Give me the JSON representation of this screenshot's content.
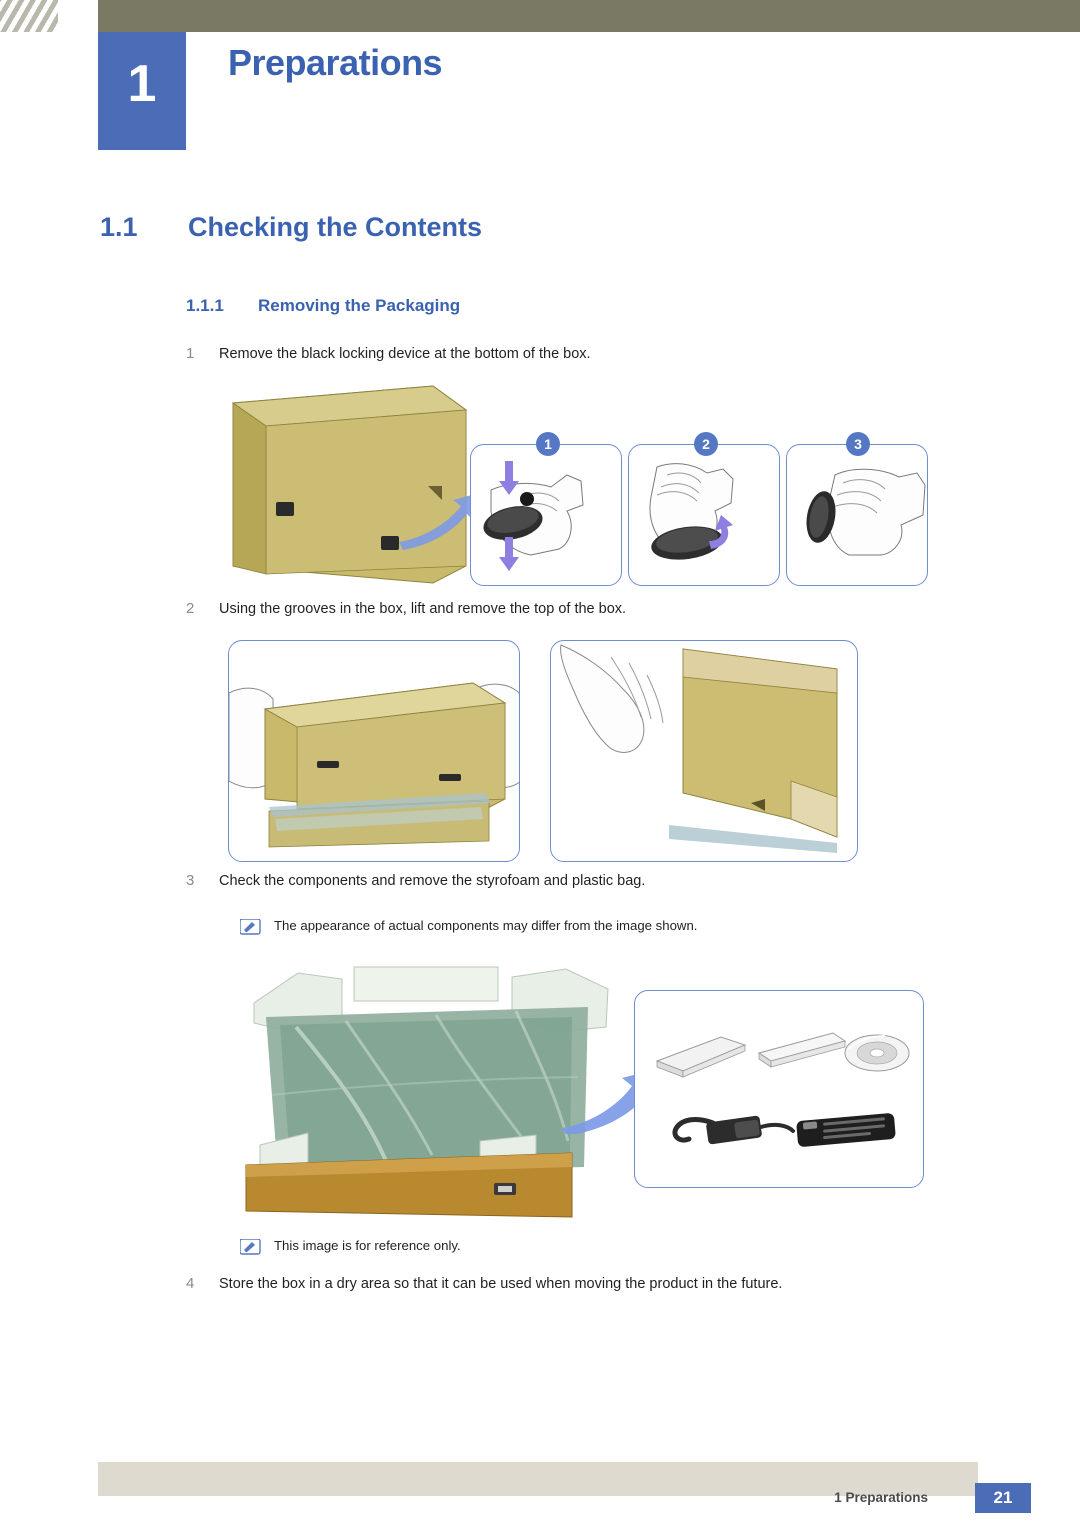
{
  "header": {
    "chapter_number": "1",
    "chapter_title": "Preparations"
  },
  "headings": {
    "h1_number": "1.1",
    "h1_text": "Checking the Contents",
    "h2_number": "1.1.1",
    "h2_text": "Removing the Packaging"
  },
  "steps": [
    {
      "num": "1",
      "text": "Remove the black locking device at the bottom of the box."
    },
    {
      "num": "2",
      "text": "Using the grooves in the box, lift and remove the top of the box."
    },
    {
      "num": "3",
      "text": "Check the components and remove the styrofoam and plastic bag."
    },
    {
      "num": "4",
      "text": "Store the box in a dry area so that it can be used when moving the product in the future."
    }
  ],
  "notes": [
    {
      "text": "The appearance of actual components may differ from the image shown."
    },
    {
      "text": "This image is for reference only."
    }
  ],
  "figure_badges": {
    "one": "1",
    "two": "2",
    "three": "3"
  },
  "footer": {
    "chapter_label": "1 Preparations",
    "page_number": "21"
  },
  "colors": {
    "accent_blue": "#3a62b0",
    "chapter_block": "#4b6cb7",
    "header_band": "#7a7a64",
    "footer_band": "#dedacf",
    "frame_border": "#6f8ed0",
    "step_number": "#8a8a8a",
    "box_tan": "#c8b96a",
    "arrow_blue": "#6f8ee0"
  }
}
